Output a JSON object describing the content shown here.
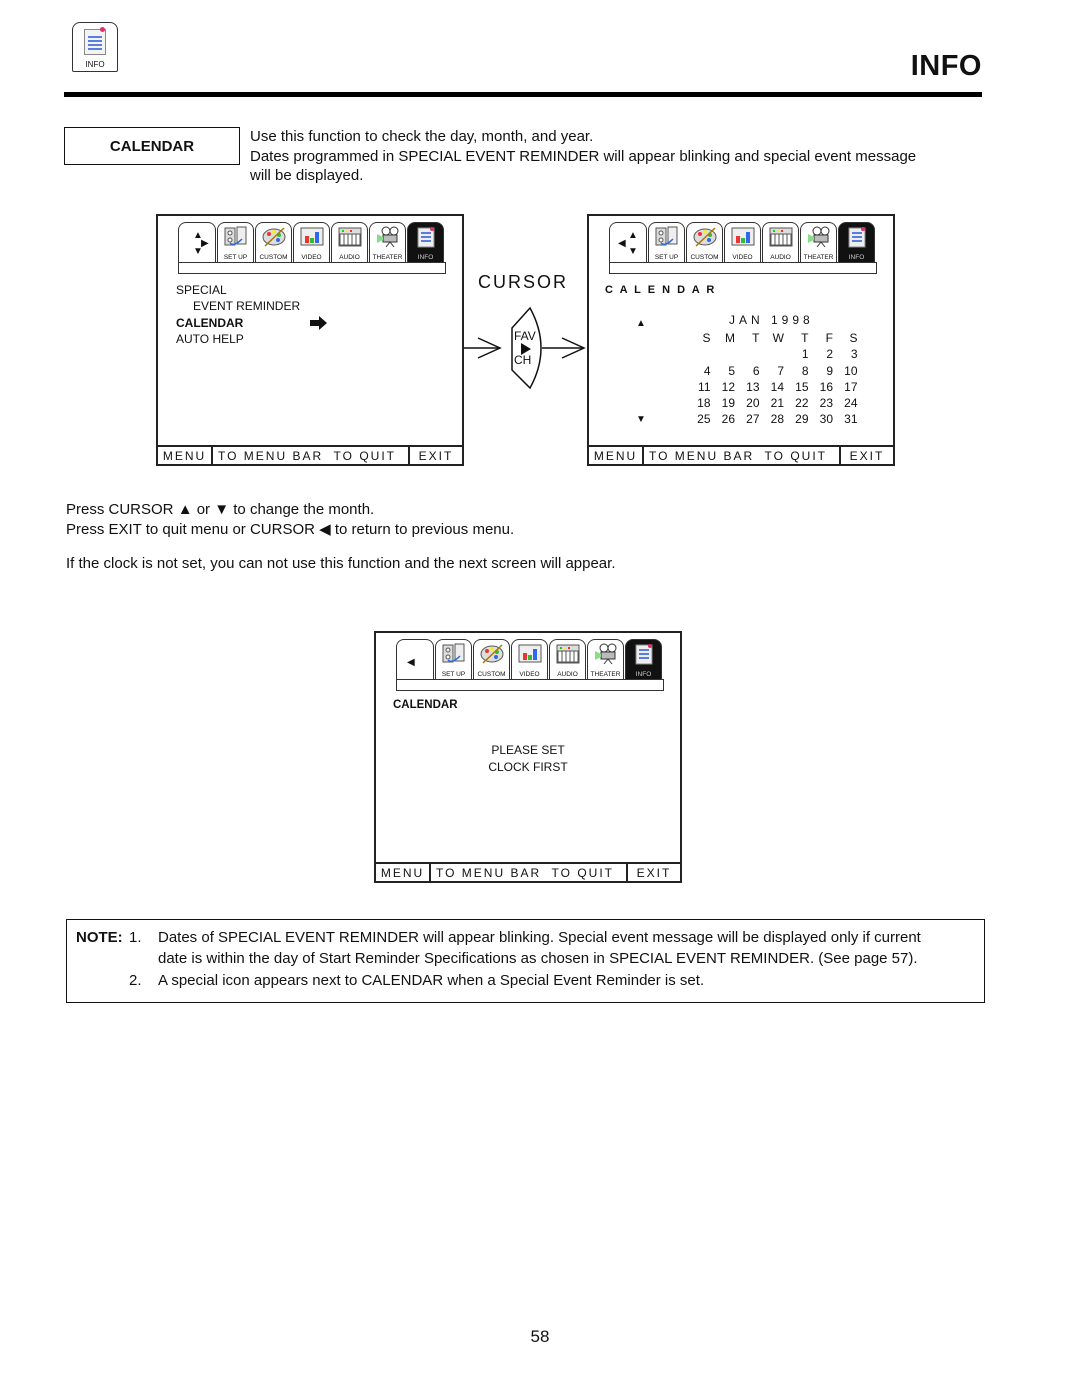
{
  "header": {
    "corner_icon": {
      "name": "info-icon",
      "label": "INFO"
    },
    "title": "INFO"
  },
  "section": {
    "label": "CALENDAR",
    "intro_lines": [
      "Use this function to check the day, month, and year.",
      "Dates programmed in SPECIAL EVENT REMINDER will appear blinking and special event message",
      "will be displayed."
    ]
  },
  "menu_tabs": [
    {
      "label": "SET UP",
      "icon": "setup-icon"
    },
    {
      "label": "CUSTOM",
      "icon": "palette-icon"
    },
    {
      "label": "VIDEO",
      "icon": "video-icon"
    },
    {
      "label": "AUDIO",
      "icon": "keyboard-icon"
    },
    {
      "label": "THEATER",
      "icon": "projector-icon"
    },
    {
      "label": "INFO",
      "icon": "info-icon",
      "active": true
    }
  ],
  "footer": {
    "menu": "MENU",
    "to_menu_bar": "TO MENU BAR",
    "to_quit": "TO QUIT",
    "exit": "EXIT"
  },
  "screen1": {
    "items": [
      "SPECIAL",
      "EVENT REMINDER",
      "CALENDAR",
      "AUTO HELP"
    ],
    "selected": "CALENDAR"
  },
  "cursor": {
    "label": "CURSOR",
    "button_top": "FAV",
    "button_bottom": "CH"
  },
  "screen2": {
    "heading": "C A L E N D A R",
    "month_year": "JAN 1998",
    "weekdays": [
      "S",
      "M",
      "T",
      "W",
      "T",
      "F",
      "S"
    ],
    "weeks": [
      [
        "",
        "",
        "",
        "",
        "1",
        "2",
        "3"
      ],
      [
        "4",
        "5",
        "6",
        "7",
        "8",
        "9",
        "10"
      ],
      [
        "11",
        "12",
        "13",
        "14",
        "15",
        "16",
        "17"
      ],
      [
        "18",
        "19",
        "20",
        "21",
        "22",
        "23",
        "24"
      ],
      [
        "25",
        "26",
        "27",
        "28",
        "29",
        "30",
        "31"
      ]
    ]
  },
  "instructions": {
    "line1_a": "Press CURSOR",
    "line1_b": "or",
    "line1_c": "to change the month.",
    "line2_a": "Press EXIT to quit menu or CURSOR",
    "line2_b": "to return to previous menu.",
    "line3": "If the clock is not set, you can not use this function and the next screen will appear."
  },
  "screen3": {
    "heading": "CALENDAR",
    "message_lines": [
      "PLEASE SET",
      "CLOCK FIRST"
    ]
  },
  "note": {
    "label": "NOTE:",
    "items": [
      {
        "num": "1.",
        "lines": [
          "Dates of SPECIAL EVENT REMINDER will appear blinking.  Special event message will be displayed only if current",
          "date is within the day of Start Reminder Specifications as chosen in SPECIAL EVENT REMINDER. (See page 57)."
        ]
      },
      {
        "num": "2.",
        "lines": [
          "A special icon appears next to  CALENDAR  when a Special Event Reminder is set."
        ]
      }
    ]
  },
  "page_number": "58"
}
